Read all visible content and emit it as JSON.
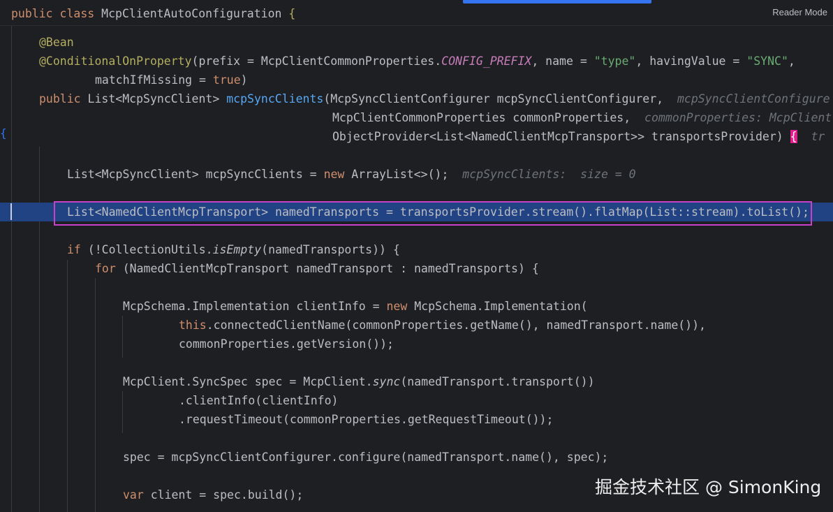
{
  "header": {
    "class_decl_kw1": "public",
    "class_decl_kw2": "class",
    "class_name": "McpClientAutoConfiguration",
    "class_brace": "{",
    "reader_mode": "Reader Mode"
  },
  "code": {
    "l1_ann": "@Bean",
    "l2_ann": "@ConditionalOnProperty",
    "l2_a": "(prefix = McpClientCommonProperties.",
    "l2_const": "CONFIG_PREFIX",
    "l2_b": ", name = ",
    "l2_str1": "\"type\"",
    "l2_c": ", havingValue = ",
    "l2_str2": "\"SYNC\"",
    "l2_d": ",",
    "l3_a": "matchIfMissing = ",
    "l3_kw": "true",
    "l3_b": ")",
    "l4_kw": "public",
    "l4_a": " List<McpSyncClient> ",
    "l4_fn": "mcpSyncClients",
    "l4_b": "(McpSyncClientConfigurer mcpSyncClientConfigurer,",
    "l4_hint": "mcpSyncClientConfigure",
    "l5_a": "McpClientCommonProperties commonProperties,",
    "l5_hint": "commonProperties: McpClient",
    "l6_a": "ObjectProvider<List<NamedClientMcpTransport>> transportsProvider) ",
    "l6_brace": "{",
    "l6_hint": "tr",
    "l7_a": "List<McpSyncClient> mcpSyncClients = ",
    "l7_kw": "new",
    "l7_b": " ArrayList<>();",
    "l7_hint": "mcpSyncClients:  size = 0",
    "l8_a": "List<NamedClientMcpTransport> namedTransports = transportsProvider.stream().flatMap(List::stream).toList();",
    "l9_kw": "if",
    "l9_a": " (!CollectionUtils.",
    "l9_it": "isEmpty",
    "l9_b": "(namedTransports)) {",
    "l10_kw": "for",
    "l10_a": " (NamedClientMcpTransport namedTransport : namedTransports) {",
    "l11_a": "McpSchema.Implementation clientInfo = ",
    "l11_kw": "new",
    "l11_b": " McpSchema.Implementation(",
    "l12_kw": "this",
    "l12_a": ".connectedClientName(commonProperties.getName(), namedTransport.name()),",
    "l13_a": "commonProperties.getVersion());",
    "l14_a": "McpClient.SyncSpec spec = McpClient.",
    "l14_it": "sync",
    "l14_b": "(namedTransport.transport())",
    "l15_a": ".clientInfo(clientInfo)",
    "l16_a": ".requestTimeout(commonProperties.getRequestTimeout());",
    "l17_a": "spec = mcpSyncClientConfigurer.configure(namedTransport.name(), spec);",
    "l18_kw": "var",
    "l18_a": " client = spec.build();"
  },
  "gutter_brace": "{",
  "watermark": "掘金技术社区 @ SimonKing",
  "colors": {
    "background": "#1e1f22",
    "keyword": "#cf8e6d",
    "annotation": "#b3ae60",
    "method": "#56a8f5",
    "string": "#6aab73",
    "constant": "#c77dbb",
    "hint": "#6f737a",
    "current_line": "#214283",
    "highlight_box": "#c940c9"
  }
}
